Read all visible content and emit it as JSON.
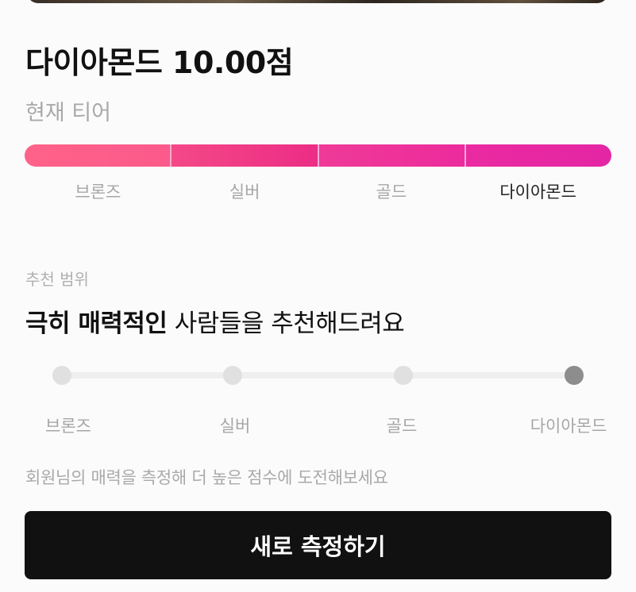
{
  "score": {
    "title": "다이아몬드 10.00점"
  },
  "current_tier": {
    "label": "현재 티어",
    "tiers": [
      "브론즈",
      "실버",
      "골드",
      "다이아몬드"
    ],
    "active_index": 3
  },
  "recommendation": {
    "caption": "추천 범위",
    "headline_bold": "극히 매력적인",
    "headline_rest": " 사람들을 추천해드려요",
    "steps": [
      "브론즈",
      "실버",
      "골드",
      "다이아몬드"
    ],
    "active_index": 3
  },
  "hint": "회원님의 매력을 측정해 더 높은 점수에 도전해보세요",
  "cta": {
    "label": "새로 측정하기"
  },
  "colors": {
    "accent": "#ec2d86",
    "button": "#111111",
    "active_dot": "#8d8d8d"
  }
}
